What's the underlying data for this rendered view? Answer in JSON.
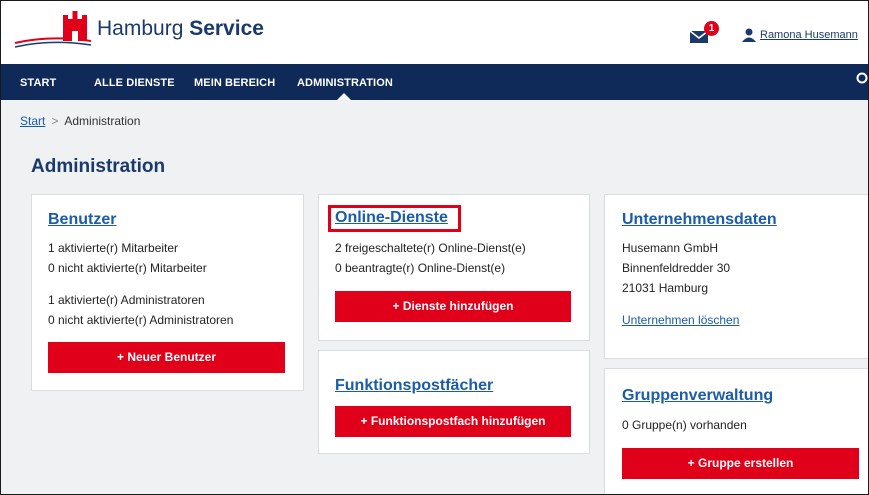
{
  "header": {
    "brand_part1": "Hamburg ",
    "brand_part2": "Service",
    "mail_count": "1",
    "user_name": "Ramona Husemann"
  },
  "nav": {
    "items": [
      "START",
      "ALLE DIENSTE",
      "MEIN BEREICH",
      "ADMINISTRATION"
    ]
  },
  "breadcrumb": {
    "start": "Start",
    "separator": ">",
    "current": "Administration"
  },
  "page_title": "Administration",
  "cards": {
    "benutzer": {
      "title": "Benutzer",
      "lines": [
        "1 aktivierte(r) Mitarbeiter",
        "0 nicht aktivierte(r) Mitarbeiter",
        "1 aktivierte(r) Administratoren",
        "0 nicht aktivierte(r) Administratoren"
      ],
      "button": "+ Neuer Benutzer"
    },
    "online_dienste": {
      "title": "Online-Dienste",
      "lines": [
        "2 freigeschaltete(r) Online-Dienst(e)",
        "0 beantragte(r) Online-Dienst(e)"
      ],
      "button": "+ Dienste hinzufügen"
    },
    "funktionspostfaecher": {
      "title": "Funktionspostfächer",
      "button": "+ Funktionspostfach hinzufügen"
    },
    "unternehmensdaten": {
      "title": "Unternehmensdaten",
      "lines": [
        "Husemann GmbH",
        "Binnenfeldredder 30",
        "21031 Hamburg"
      ],
      "link": "Unternehmen löschen"
    },
    "gruppenverwaltung": {
      "title": "Gruppenverwaltung",
      "lines": [
        "0 Gruppe(n) vorhanden"
      ],
      "button": "+ Gruppe erstellen"
    }
  },
  "colors": {
    "nav_bg": "#0f2a58",
    "accent_red": "#e10019",
    "link_blue": "#1a5ca8",
    "title_navy": "#1a3a6b",
    "page_bg": "#f0f1f2"
  },
  "icons": [
    "hamburg-crest-icon",
    "mail-icon",
    "user-icon",
    "search-icon"
  ]
}
